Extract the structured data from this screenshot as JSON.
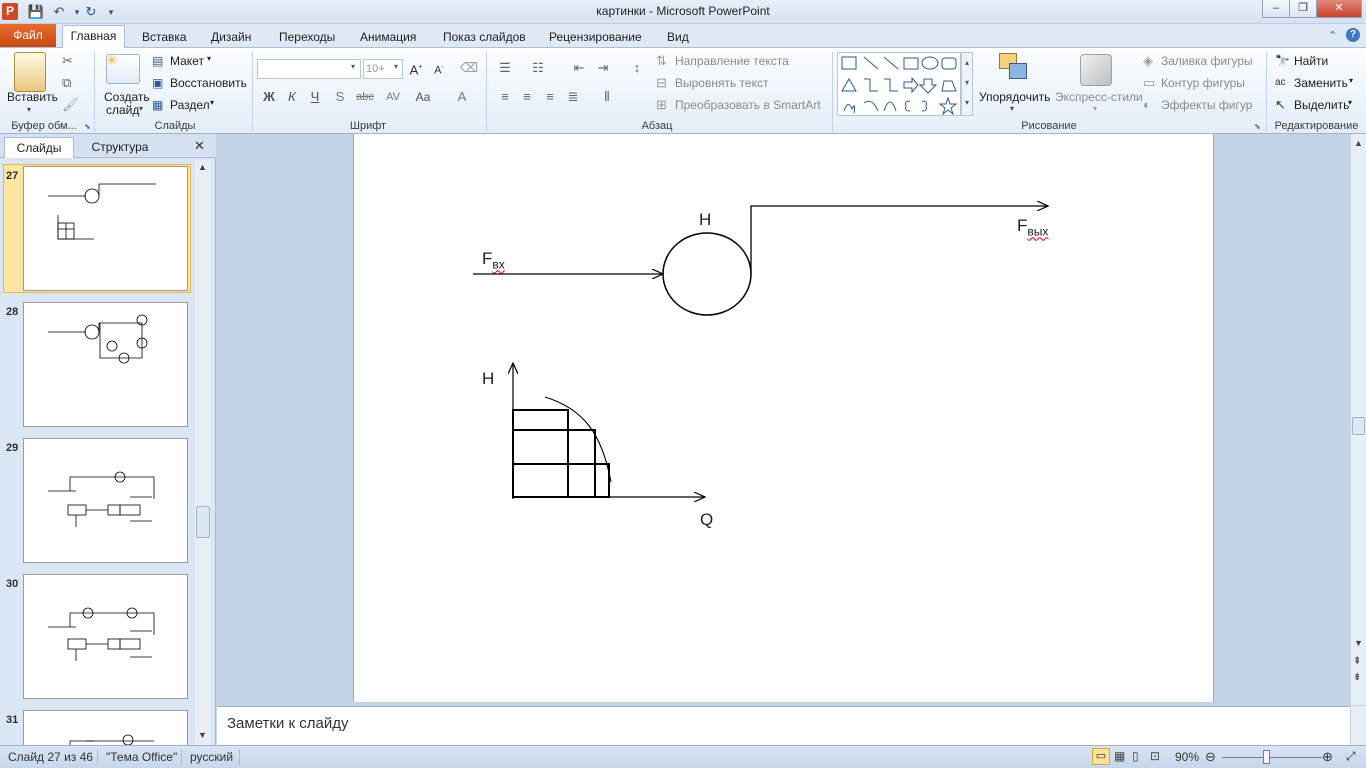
{
  "window": {
    "title": "картинки  -  Microsoft PowerPoint",
    "controls": {
      "minimize": "‒",
      "maximize": "❐",
      "close": "✕"
    }
  },
  "quick_access": {
    "app_icon": "P",
    "save_icon": "save-icon",
    "undo_icon": "undo-icon",
    "redo_icon": "redo-icon"
  },
  "tabs": {
    "file": "Файл",
    "items": [
      "Главная",
      "Вставка",
      "Дизайн",
      "Переходы",
      "Анимация",
      "Показ слайдов",
      "Рецензирование",
      "Вид"
    ]
  },
  "ribbon": {
    "clipboard": {
      "label": "Буфер обм...",
      "paste": "Вставить"
    },
    "slides": {
      "label": "Слайды",
      "new_slide_1": "Создать",
      "new_slide_2": "слайд",
      "layout": "Макет",
      "reset": "Восстановить",
      "section": "Раздел"
    },
    "font": {
      "label": "Шрифт",
      "font_name": "",
      "font_size": "10+",
      "bold": "Ж",
      "italic": "К",
      "underline": "Ч",
      "shadow": "S",
      "strike": "abc",
      "spacing": "AV",
      "case": "Aa",
      "color": "A"
    },
    "paragraph": {
      "label": "Абзац",
      "text_direction": "Направление текста",
      "align_text": "Выровнять текст",
      "convert_smartart": "Преобразовать в SmartArt"
    },
    "drawing": {
      "label": "Рисование",
      "arrange": "Упорядочить",
      "quick_styles": "Экспресс-стили",
      "fill": "Заливка фигуры",
      "outline": "Контур фигуры",
      "effects": "Эффекты фигур"
    },
    "editing": {
      "label": "Редактирование",
      "find": "Найти",
      "replace": "Заменить",
      "select": "Выделить"
    }
  },
  "pane": {
    "tab_slides": "Слайды",
    "tab_outline": "Структура",
    "slide_numbers": [
      "27",
      "28",
      "29",
      "30",
      "31"
    ]
  },
  "slide": {
    "label_h_top": "H",
    "label_fin_main": "F",
    "label_fin_sub": "вх",
    "label_fout_main": "F",
    "label_fout_sub": "вых",
    "axis_y": "H",
    "axis_x": "Q"
  },
  "notes": {
    "placeholder": "Заметки к слайду"
  },
  "status": {
    "slide_info": "Слайд 27 из 46",
    "theme": "\"Тема Office\"",
    "language": "русский",
    "zoom": "90%"
  }
}
